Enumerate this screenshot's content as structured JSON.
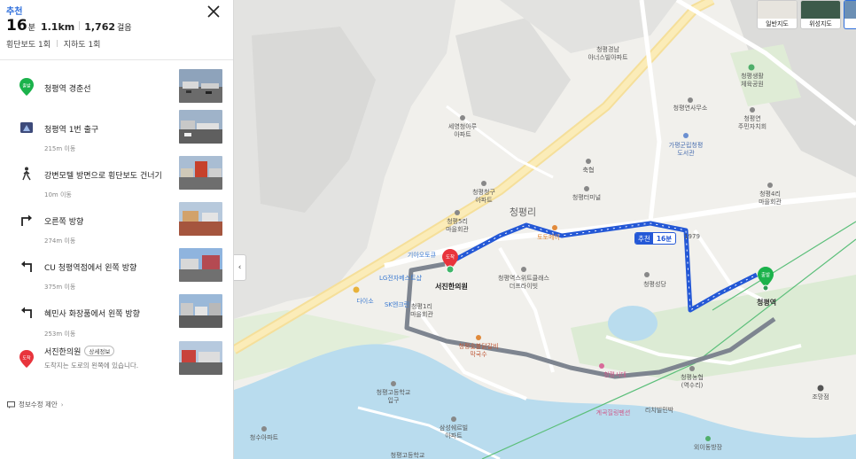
{
  "summary": {
    "recommend": "추천",
    "minutes": "16",
    "minutes_unit": "분",
    "distance": "1.1km",
    "steps": "1,762",
    "steps_unit": "걸음",
    "crosswalk": "횡단보도 1회",
    "underpass": "지하도 1회"
  },
  "steps": [
    {
      "label": "청평역 경춘선",
      "icon": "start-marker-icon",
      "marker_text": "출발"
    },
    {
      "label": "청평역 1번 출구",
      "icon": "exit-icon"
    },
    {
      "label": "강변모텔 방면으로 횡단보도 건너기",
      "icon": "pedestrian-icon"
    },
    {
      "label": "오른쪽 방향",
      "icon": "turn-right-icon"
    },
    {
      "label": "CU 청평역점에서 왼쪽 방향",
      "icon": "turn-left-icon"
    },
    {
      "label": "혜민사 화장품에서 왼쪽 방향",
      "icon": "turn-left-icon"
    },
    {
      "label": "서진한의원",
      "icon": "arrive-marker-icon",
      "marker_text": "도착",
      "badge": "상세정보",
      "sub": "도착지는 도로의 왼쪽에 있습니다."
    }
  ],
  "distances": [
    "215m 이동",
    "10m 이동",
    "274m 이동",
    "375m 이동",
    "253m 이동"
  ],
  "suggest": "정보수정 제안",
  "map": {
    "maptypes": [
      "일반지도",
      "위성지도"
    ],
    "route_badge": {
      "rec": "추천",
      "time": "16분"
    },
    "dest_marker": "도착",
    "start_marker": "출발",
    "labels": {
      "seojin": "서진한의원",
      "cheongpyeong_station": "청평역",
      "cheongpyeong_ri": "청평리",
      "apt1": "청평경남",
      "apt1b": "아너스빌아파트",
      "sports_park1": "청평생활",
      "sports_park2": "체육공원",
      "lighthouse": "청평연사무소",
      "center1": "청평연",
      "center2": "주민자치회",
      "library1": "가평군립청평",
      "library2": "도서관",
      "seyoung1": "세영청아루",
      "seyoung2": "아파트",
      "chukhyeop": "축협",
      "terminal": "청평터미널",
      "hall4a": "청평4리",
      "hall4b": "마을회관",
      "apt2a": "청평청구",
      "apt2b": "아파트",
      "hall5a": "청평5리",
      "hall5b": "마을회관",
      "giaeo": "기아오토큐",
      "lg": "LG전자베스트샵",
      "daiso": "다이소",
      "sk": "SK엔크린",
      "hall1a": "청평1리",
      "hall1b": "마을회관",
      "theplus1": "청평역스위트클래스",
      "theplus2": "더프라이빗",
      "sangdang": "청평성당",
      "y1979": "1979",
      "galbi1": "청평숯불닭갈비",
      "galbi2": "막국수",
      "school1": "청평고등학교",
      "school2": "입구",
      "samsung1": "삼성쉐르빌",
      "samsung2": "아파트",
      "cheongsu": "청수아파트",
      "bridge": "청평고등학교",
      "nurse1": "청평농협",
      "nurse2": "(역수리)",
      "inn": "리치빌민박",
      "pension": "계곡힐링펜션",
      "sidae": "청평시대",
      "jomang": "조망점",
      "parking": "외이동방장",
      "cafe": "토토메이"
    }
  },
  "colors": {
    "route": "#2458d6",
    "walk_gray": "#7e8590",
    "start": "#1bb24b",
    "arrive": "#e8343c",
    "accent": "#2f6fdc"
  }
}
